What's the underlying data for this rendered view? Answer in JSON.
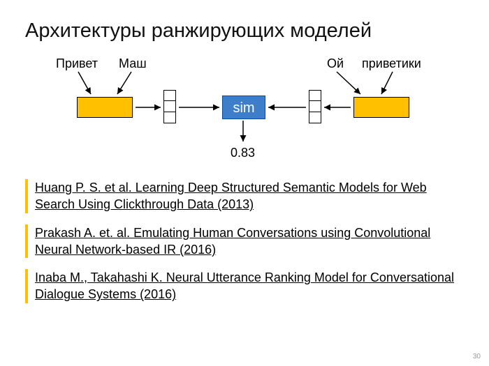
{
  "title": "Архитектуры ранжирующих моделей",
  "diagram": {
    "left_words": [
      "Привет",
      "Маш"
    ],
    "right_words": [
      "Ой",
      "приветики"
    ],
    "sim_label": "sim",
    "output": "0.83"
  },
  "references": [
    "Huang P. S. et al. Learning Deep Structured Semantic Models for Web Search Using Clickthrough Data (2013)",
    "Prakash A. et. al. Emulating Human Conversations using Convolutional Neural Network-based IR (2016)",
    "Inaba M., Takahashi K. Neural Utterance Ranking Model for Conversational Dialogue Systems (2016)"
  ],
  "page_number": "30"
}
